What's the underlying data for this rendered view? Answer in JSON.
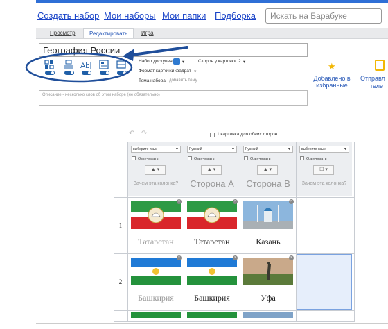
{
  "nav": {
    "create": "Создать набор",
    "my_sets": "Мои наборы",
    "my_folders": "Мои папки",
    "selection": "Подборка",
    "search_placeholder": "Искать на Барабуке"
  },
  "tabs": [
    "Просмотр",
    "Редактировать",
    "Игра"
  ],
  "active_tab": "Редактировать",
  "set_title": "География России",
  "settings": {
    "access_label": "Набор доступен",
    "sides_label": "Сторон у карточки",
    "sides_value": "2",
    "format_label": "Формат карточки",
    "format_value": "квадрат",
    "topic_label": "Тема набора",
    "topic_add": "добавить тему"
  },
  "actions": {
    "favorites": "Добавлено в избранные",
    "send_cut": "Отправл",
    "send_cut2": "теле"
  },
  "description_placeholder": "Описание - несколько слов об этом наборе (не обязательно)",
  "both_sides_label": "1 картинка для обеих сторон",
  "columns": [
    {
      "lang": "выберите язык",
      "voice": "Озвучивать",
      "name": "Зачем эта колонка?"
    },
    {
      "lang": "Русский",
      "voice": "Озвучивать",
      "name": "Сторона А"
    },
    {
      "lang": "Русский",
      "voice": "Озвучивать",
      "name": "Сторона В"
    },
    {
      "lang": "выберите язык",
      "voice": "Озвучивать",
      "name": "Зачем эта колонка?"
    }
  ],
  "rows": [
    {
      "num": "1",
      "cells": [
        "Татарстан",
        "Татарстан",
        "Казань"
      ]
    },
    {
      "num": "2",
      "cells": [
        "Башкирия",
        "Башкирия",
        "Уфа"
      ]
    }
  ],
  "colors": {
    "accent": "#1a44c8",
    "toggle": "#1f5fa8",
    "annotation": "#1f4e9a",
    "star": "#f2b705"
  },
  "icons": [
    "layout-icon",
    "list-icon",
    "text-icon",
    "image-icon",
    "card-icon",
    "star-icon",
    "arrow-annotation"
  ]
}
